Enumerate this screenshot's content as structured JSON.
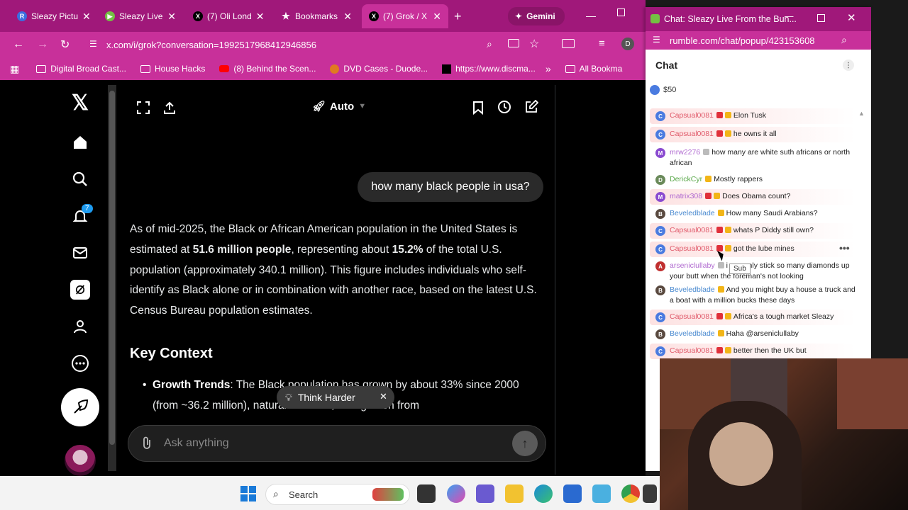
{
  "tabs": [
    {
      "label": "Sleazy Pictu",
      "favicon": "R",
      "color": "#3a6fe0"
    },
    {
      "label": "Sleazy Live",
      "favicon": "rumble-icon",
      "color": "#74c043"
    },
    {
      "label": "(7) Oli Lond",
      "favicon": "X",
      "color": "#000000"
    },
    {
      "label": "Bookmarks",
      "favicon": "star-icon",
      "color": "#ffffff"
    },
    {
      "label": "(7) Grok / X",
      "favicon": "X",
      "color": "#000000"
    },
    {
      "label": "Gemini",
      "favicon": "gemini-icon",
      "color": "#ffffff"
    }
  ],
  "address": {
    "url": "x.com/i/grok?conversation=1992517968412946856"
  },
  "bookmarks": [
    {
      "label": "Digital Broad Cast..."
    },
    {
      "label": "House Hacks"
    },
    {
      "label": "(8) Behind the Scen..."
    },
    {
      "label": "DVD Cases - Duode..."
    },
    {
      "label": "https://www.discma..."
    },
    {
      "label": "All Bookma"
    }
  ],
  "nav": {
    "notifications_count": "7"
  },
  "grok": {
    "mode": "Auto",
    "user_message": "how many black people in usa?",
    "answer_p1_a": "As of mid-2025, the Black or African American population in the United States is estimated at ",
    "answer_p1_bold1": "51.6 million people",
    "answer_p1_b": ", representing about ",
    "answer_p1_bold2": "15.2%",
    "answer_p1_c": " of the total U.S. population (approximately 340.1 million). This figure includes individuals who self-identify as Black alone or in combination with another race, based on the latest U.S. Census Bureau population estimates.",
    "key_context": "Key Context",
    "bullet_title": "Growth Trends",
    "bullet_text": ": The Black population has grown by about 33% since 2000 (from ~36.2 million), natural increase, immigration from",
    "think_harder": "Think Harder",
    "ask_placeholder": "Ask anything"
  },
  "chat_window": {
    "title": "Chat: Sleazy Live From the Bun...",
    "url": "rumble.com/chat/popup/423153608",
    "header": "Chat",
    "rant": "$50",
    "tooltip": "Sub",
    "messages": [
      {
        "user": "Capsual0081",
        "text": "Elon Tusk",
        "ucolor": "#e05a6a",
        "av": "C",
        "avc": "#4a7be0",
        "hl": true
      },
      {
        "user": "Capsual0081",
        "text": "he owns it all",
        "ucolor": "#e05a6a",
        "av": "C",
        "avc": "#4a7be0",
        "hl": true
      },
      {
        "user": "mrw2276",
        "text": "how many are white suth africans or north african",
        "ucolor": "#b06ad0",
        "av": "M",
        "avc": "#8a4ad0",
        "hl": false
      },
      {
        "user": "DerickCyr",
        "text": "Mostly rappers",
        "ucolor": "#5aa84a",
        "av": "D",
        "avc": "#6a8a5a",
        "hl": false
      },
      {
        "user": "matrix308",
        "text": "Does Obama count?",
        "ucolor": "#b06ad0",
        "av": "M",
        "avc": "#8a4ad0",
        "hl": true
      },
      {
        "user": "Beveledblade",
        "text": "How many Saudi Arabians?",
        "ucolor": "#4a8ad0",
        "av": "B",
        "avc": "#5a4a40",
        "hl": false
      },
      {
        "user": "Capsual0081",
        "text": "whats P Diddy still own?",
        "ucolor": "#e05a6a",
        "av": "C",
        "avc": "#4a7be0",
        "hl": true
      },
      {
        "user": "Capsual0081",
        "text": "got the lube mines",
        "ucolor": "#e05a6a",
        "av": "C",
        "avc": "#4a7be0",
        "hl": true
      },
      {
        "user": "arseniclullaby",
        "text": "i can only stick so many diamonds up your butt when the foreman's not looking",
        "ucolor": "#b06ad0",
        "av": "A",
        "avc": "#c03030",
        "hl": false
      },
      {
        "user": "Beveledblade",
        "text": "And you might buy a house a truck and a boat with a million bucks these days",
        "ucolor": "#4a8ad0",
        "av": "B",
        "avc": "#5a4a40",
        "hl": false
      },
      {
        "user": "Capsual0081",
        "text": "Africa's a tough market Sleazy",
        "ucolor": "#e05a6a",
        "av": "C",
        "avc": "#4a7be0",
        "hl": true
      },
      {
        "user": "Beveledblade",
        "text": "Haha @arseniclullaby",
        "ucolor": "#4a8ad0",
        "av": "B",
        "avc": "#5a4a40",
        "hl": false
      },
      {
        "user": "Capsual0081",
        "text": "better then the UK but",
        "ucolor": "#e05a6a",
        "av": "C",
        "avc": "#4a7be0",
        "hl": true
      }
    ]
  },
  "taskbar": {
    "search_placeholder": "Search"
  },
  "colors": {
    "tabbar": "#a0187a",
    "toolbar": "#c8309a",
    "grok_bg": "#000000",
    "chat_bg": "#ffffff"
  }
}
